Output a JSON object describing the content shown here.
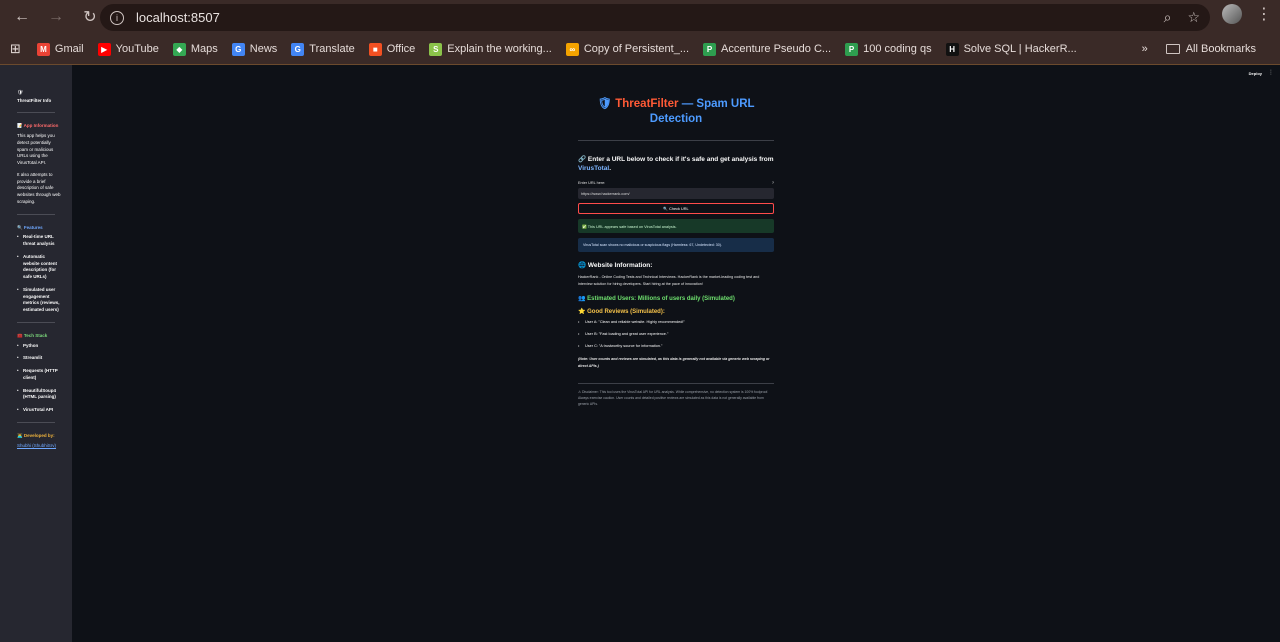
{
  "browser": {
    "url": "localhost:8507",
    "bookmarks": [
      {
        "label": "Gmail",
        "icon": "gmail-icon",
        "color": "#ea4335",
        "glyph": "M"
      },
      {
        "label": "YouTube",
        "icon": "youtube-icon",
        "color": "#ff0000",
        "glyph": "▶"
      },
      {
        "label": "Maps",
        "icon": "maps-icon",
        "color": "#34a853",
        "glyph": "◆"
      },
      {
        "label": "News",
        "icon": "news-icon",
        "color": "#4285f4",
        "glyph": "G"
      },
      {
        "label": "Translate",
        "icon": "translate-icon",
        "color": "#4285f4",
        "glyph": "G"
      },
      {
        "label": "Office",
        "icon": "office-icon",
        "color": "#f25022",
        "glyph": "■"
      },
      {
        "label": "Explain the working...",
        "icon": "doc-icon",
        "color": "#8bc34a",
        "glyph": "S"
      },
      {
        "label": "Copy of Persistent_...",
        "icon": "link-icon",
        "color": "#f4a300",
        "glyph": "∞"
      },
      {
        "label": "Accenture Pseudo C...",
        "icon": "p-icon",
        "color": "#2e9e4f",
        "glyph": "P"
      },
      {
        "label": "100 coding qs",
        "icon": "p-icon",
        "color": "#2e9e4f",
        "glyph": "P"
      },
      {
        "label": "Solve SQL | HackerR...",
        "icon": "hackerrank-icon",
        "color": "#111111",
        "glyph": "H"
      }
    ],
    "all_bookmarks": "All Bookmarks"
  },
  "sidebar": {
    "app_title": "ThreatFilter Info",
    "app_icon": "🛡",
    "app_info_title": "📝 App Information",
    "app_info_p1": "This app helps you detect potentially spam or malicious URLs using the VirusTotal API.",
    "app_info_p2": "It also attempts to provide a brief description of safe websites through web scraping.",
    "features_title": "🔍 Features",
    "features": [
      "Real-time URL threat analysis",
      "Automatic website content description (for safe URLs)",
      "Simulated user engagement metrics (reviews, estimated users)"
    ],
    "tech_title": "🧰 Tech Stack",
    "tech": [
      "Python",
      "Streamlit",
      "Requests (HTTP client)",
      "BeautifulSoup4 (HTML parsing)",
      "VirusTotal API"
    ],
    "dev_title": "👨‍💻 Developed by:",
    "dev_name": "Shubhi (ShubhiSrv)"
  },
  "header": {
    "deploy": "Deploy",
    "menu": "⋮"
  },
  "main": {
    "title_icon": "🛡",
    "title_brand": "ThreatFilter",
    "title_rest": " — Spam URL Detection",
    "prompt_a": "🔗 Enter a URL below to check if it's safe and get analysis from ",
    "prompt_vt": "VirusTotal",
    "prompt_end": ".",
    "input_label": "Enter URL here:",
    "input_value": "https://www.hackerrank.com/",
    "button": "🔍 Check URL",
    "ok_msg": "✅ This URL appears safe based on VirusTotal analysis.",
    "info_msg": "VirusTotal scan shows no malicious or suspicious flags (Harmless: 67, Undetected: 30).",
    "website_title": "🌐 Website Information:",
    "website_desc": "HackerRank - Online Coding Tests and Technical Interviews. HackerRank is the market-leading coding test and interview solution for hiring developers. Start hiring at the pace of innovation!",
    "users": "👥 Estimated Users: Millions of users daily (Simulated)",
    "reviews_title": "⭐ Good Reviews (Simulated):",
    "reviews": [
      "User A: \"Clean and reliable website. Highly recommended!\"",
      "User B: \"Fast loading and great user experience.\"",
      "User C: \"A trustworthy source for information.\""
    ],
    "note": "(Note: User counts and reviews are simulated, as this data is generally not available via generic web scraping or direct APIs.)",
    "disclaimer": "⚠ Disclaimer: This tool uses the VirusTotal API for URL analysis. While comprehensive, no detection system is 100% foolproof. Always exercise caution. User counts and detailed positive reviews are simulated as this data is not generally available from generic APIs."
  }
}
